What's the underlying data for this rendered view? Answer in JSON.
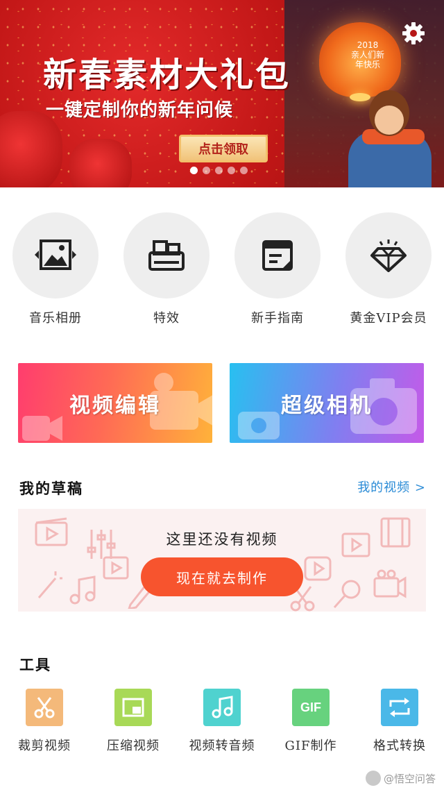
{
  "banner": {
    "title": "新春素材大礼包",
    "subtitle": "一键定制你的新年问候",
    "cta_label": "点击领取",
    "lantern_text": "2018\n亲人们新\n年快乐",
    "page_count": 5,
    "active_page": 0
  },
  "shortcuts": [
    {
      "label": "音乐相册",
      "icon": "photo-slideshow-icon"
    },
    {
      "label": "特效",
      "icon": "effects-icon"
    },
    {
      "label": "新手指南",
      "icon": "guide-icon"
    },
    {
      "label": "黄金VIP会员",
      "icon": "diamond-icon"
    }
  ],
  "cards": {
    "edit_label": "视频编辑",
    "camera_label": "超级相机"
  },
  "drafts": {
    "title": "我的草稿",
    "link_label": "我的视频 >",
    "empty_text": "这里还没有视频",
    "create_label": "现在就去制作"
  },
  "tools": {
    "title": "工具",
    "items": [
      {
        "label": "裁剪视频",
        "icon": "scissors-icon",
        "color": "#f4b97a"
      },
      {
        "label": "压缩视频",
        "icon": "compress-icon",
        "color": "#a8d957"
      },
      {
        "label": "视频转音频",
        "icon": "music-note-icon",
        "color": "#4fd2cf"
      },
      {
        "label": "GIF制作",
        "icon": "gif-icon",
        "tile_text": "GIF",
        "color": "#67d27e"
      },
      {
        "label": "格式转换",
        "icon": "convert-icon",
        "color": "#4ab8e8"
      }
    ]
  },
  "watermark": "@悟空问答",
  "colors": {
    "accent_orange": "#f7542e",
    "link_blue": "#2a8bd6"
  }
}
